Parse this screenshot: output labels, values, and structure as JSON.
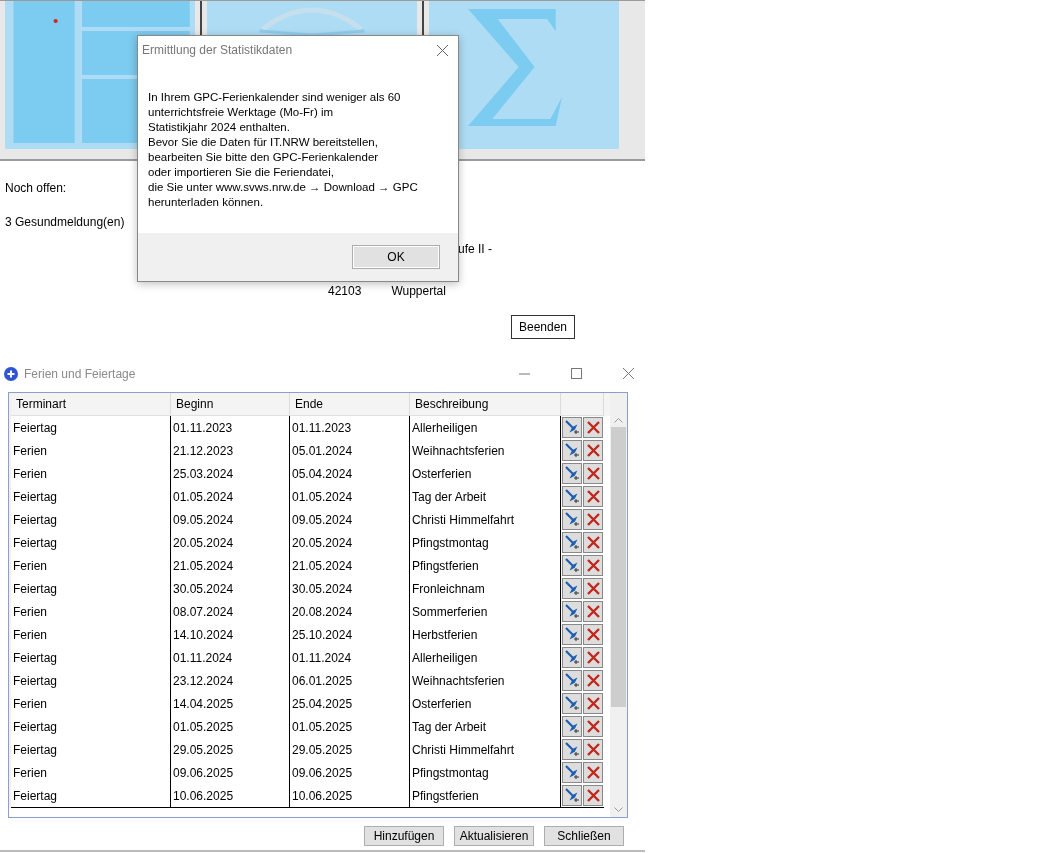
{
  "background": {
    "tiles": [
      {
        "kind": "layout"
      },
      {
        "kind": "book"
      },
      {
        "kind": "sigma"
      }
    ],
    "open_label": "Noch offen:",
    "open_items": [
      "3 Gesundmeldung(en)"
    ],
    "address_line": "ufe II -",
    "postcode": "42103",
    "city": "Wuppertal",
    "quit_button": "Beenden"
  },
  "dialog": {
    "title": "Ermittlung der Statistikdaten",
    "message": "In Ihrem GPC-Ferienkalender sind weniger als 60\nunterrichtsfreie Werktage (Mo-Fr) im\nStatistikjahr  2024 enthalten.\nBevor Sie die Daten für IT.NRW bereitstellen,\nbearbeiten Sie bitte den GPC-Ferienkalender\noder importieren Sie die Feriendatei,\ndie Sie unter www.svws.nrw.de → Download → GPC\nherunterladen können.",
    "ok_button": "OK"
  },
  "window": {
    "title": "Ferien und Feiertage",
    "columns": [
      "Terminart",
      "Beginn",
      "Ende",
      "Beschreibung"
    ],
    "rows": [
      {
        "terminart": "Feiertag",
        "beginn": "01.11.2023",
        "ende": "01.11.2023",
        "beschreibung": "Allerheiligen"
      },
      {
        "terminart": "Ferien",
        "beginn": "21.12.2023",
        "ende": "05.01.2024",
        "beschreibung": "Weihnachtsferien"
      },
      {
        "terminart": "Ferien",
        "beginn": "25.03.2024",
        "ende": "05.04.2024",
        "beschreibung": "Osterferien"
      },
      {
        "terminart": "Feiertag",
        "beginn": "01.05.2024",
        "ende": "01.05.2024",
        "beschreibung": "Tag der Arbeit"
      },
      {
        "terminart": "Feiertag",
        "beginn": "09.05.2024",
        "ende": "09.05.2024",
        "beschreibung": "Christi Himmelfahrt"
      },
      {
        "terminart": "Feiertag",
        "beginn": "20.05.2024",
        "ende": "20.05.2024",
        "beschreibung": "Pfingstmontag"
      },
      {
        "terminart": "Ferien",
        "beginn": "21.05.2024",
        "ende": "21.05.2024",
        "beschreibung": "Pfingstferien"
      },
      {
        "terminart": "Feiertag",
        "beginn": "30.05.2024",
        "ende": "30.05.2024",
        "beschreibung": "Fronleichnam"
      },
      {
        "terminart": "Ferien",
        "beginn": "08.07.2024",
        "ende": "20.08.2024",
        "beschreibung": "Sommerferien"
      },
      {
        "terminart": "Ferien",
        "beginn": "14.10.2024",
        "ende": "25.10.2024",
        "beschreibung": "Herbstferien"
      },
      {
        "terminart": "Feiertag",
        "beginn": "01.11.2024",
        "ende": "01.11.2024",
        "beschreibung": "Allerheiligen"
      },
      {
        "terminart": "Feiertag",
        "beginn": "23.12.2024",
        "ende": "06.01.2025",
        "beschreibung": "Weihnachtsferien"
      },
      {
        "terminart": "Ferien",
        "beginn": "14.04.2025",
        "ende": "25.04.2025",
        "beschreibung": "Osterferien"
      },
      {
        "terminart": "Feiertag",
        "beginn": "01.05.2025",
        "ende": "01.05.2025",
        "beschreibung": "Tag der Arbeit"
      },
      {
        "terminart": "Feiertag",
        "beginn": "29.05.2025",
        "ende": "29.05.2025",
        "beschreibung": "Christi Himmelfahrt"
      },
      {
        "terminart": "Ferien",
        "beginn": "09.06.2025",
        "ende": "09.06.2025",
        "beschreibung": "Pfingstmontag"
      },
      {
        "terminart": "Feiertag",
        "beginn": "10.06.2025",
        "ende": "10.06.2025",
        "beschreibung": "Pfingstferien"
      }
    ],
    "buttons": [
      "Hinzufügen",
      "Aktualisieren",
      "Schließen"
    ]
  }
}
